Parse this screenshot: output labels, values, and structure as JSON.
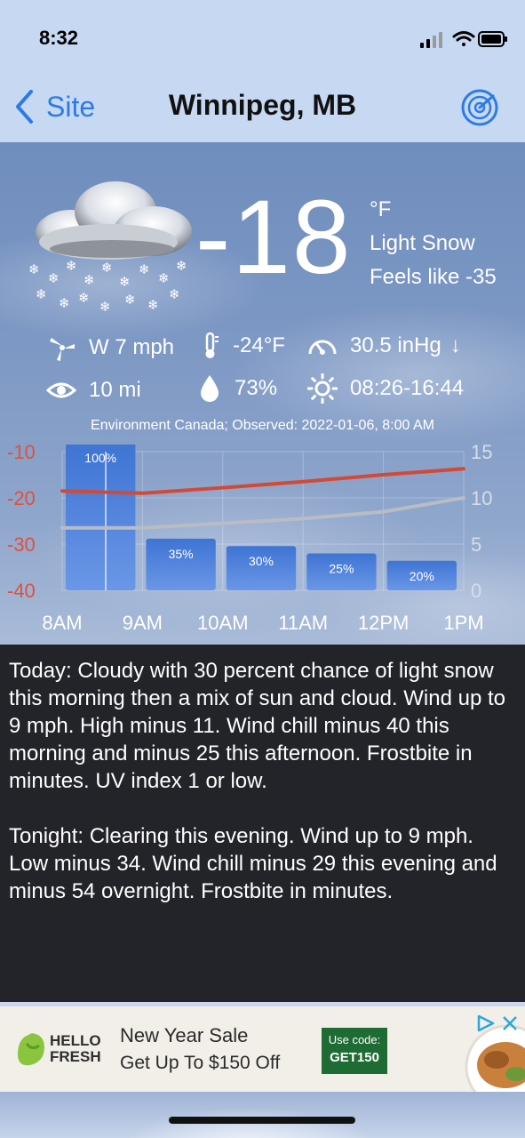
{
  "status_bar": {
    "time": "8:32"
  },
  "nav": {
    "back_label": "Site",
    "title": "Winnipeg, MB"
  },
  "current": {
    "temperature": "-18",
    "unit": "°F",
    "condition": "Light Snow",
    "feels_like": "Feels like -35",
    "wind": "W 7 mph",
    "dew_point": "-24°F",
    "pressure": "30.5 inHg",
    "pressure_trend": "↓",
    "visibility": "10 mi",
    "humidity": "73%",
    "sun": "08:26-16:44",
    "source": "Environment Canada; Observed: 2022-01-06, 8:00 AM"
  },
  "icons": {
    "weather": "cloud-snow-icon",
    "wind": "wind-turbine-icon",
    "dew_point": "thermometer-icon",
    "pressure": "barometer-icon",
    "visibility": "eye-icon",
    "humidity": "droplet-icon",
    "sun": "sun-icon"
  },
  "chart_data": {
    "type": "bar",
    "categories": [
      "8AM",
      "9AM",
      "10AM",
      "11AM",
      "12PM",
      "1PM"
    ],
    "bar_labels": [
      "100%",
      "35%",
      "30%",
      "25%",
      "20%"
    ],
    "precip_percent": [
      100,
      35,
      30,
      25,
      20
    ],
    "left_ticks": [
      "-10",
      "-20",
      "-30",
      "-40"
    ],
    "left_ylim": [
      -40,
      -10
    ],
    "right_ticks": [
      "15",
      "10",
      "5",
      "0"
    ],
    "right_ylim": [
      0,
      15
    ],
    "series": [
      {
        "x": [
          8,
          9,
          10,
          11,
          12,
          13
        ],
        "values": [
          -18.5,
          -19,
          -17.8,
          -16.5,
          -15,
          -13.7
        ],
        "color": "#d14a35"
      },
      {
        "x": [
          8,
          9,
          10,
          11,
          12,
          13
        ],
        "values": [
          -26.5,
          -26.5,
          -25.5,
          -24.5,
          -23,
          -20
        ],
        "color": "#b8bcc4"
      }
    ],
    "grid": true
  },
  "forecast": {
    "today": "Today:  Cloudy with 30 percent chance of light snow this morning then a mix of sun and cloud. Wind up to 9 mph. High minus 11. Wind chill minus 40 this morning and minus 25 this afternoon. Frostbite in minutes. UV index 1 or low.",
    "tonight": "Tonight:  Clearing this evening. Wind up to 9 mph. Low minus 34. Wind chill minus 29 this evening and minus 54 overnight. Frostbite in minutes."
  },
  "ad": {
    "brand": "HELLO FRESH",
    "brand_line1": "HELLO",
    "brand_line2": "FRESH",
    "headline": "New Year Sale",
    "subline": "Get Up To $150 Off",
    "code_label": "Use code:",
    "code": "GET150"
  },
  "colors": {
    "accent": "#2c7be5",
    "bar": "#4f82d8",
    "high_line": "#d14a35",
    "low_line": "#b8bcc4",
    "axis_left": "#e0503a",
    "forecast_bg": "#232429"
  }
}
